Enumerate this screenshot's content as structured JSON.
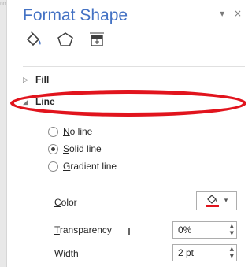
{
  "pane": {
    "title": "Format Shape",
    "pin_glyph": "▾",
    "close_glyph": "×",
    "tabs": [
      {
        "name": "fill-line-tab",
        "icon": "paint-bucket-icon",
        "active": true
      },
      {
        "name": "effects-tab",
        "icon": "pentagon-icon",
        "active": false
      },
      {
        "name": "size-properties-tab",
        "icon": "size-properties-icon",
        "active": false
      }
    ]
  },
  "sections": {
    "fill": {
      "label": "Fill",
      "arrow": "▷"
    },
    "line": {
      "label": "Line",
      "arrow": "◢"
    }
  },
  "line_options": {
    "no_line": {
      "accel": "N",
      "rest": "o line",
      "checked": false
    },
    "solid_line": {
      "accel": "S",
      "rest": "olid line",
      "checked": true
    },
    "gradient_line": {
      "accel": "G",
      "rest": "radient line",
      "checked": false
    }
  },
  "properties": {
    "color": {
      "accel": "C",
      "rest": "olor",
      "swatch": "#e1141d",
      "dropdown_glyph": "▾"
    },
    "transparency": {
      "accel": "T",
      "rest": "ransparency",
      "value": "0%"
    },
    "width": {
      "accel": "W",
      "rest": "idth",
      "value": "2 pt"
    }
  },
  "spin_glyphs": {
    "up": "▲",
    "down": "▼"
  },
  "annotation": {
    "color": "#e1141d"
  },
  "accent_color": "#4472c4"
}
